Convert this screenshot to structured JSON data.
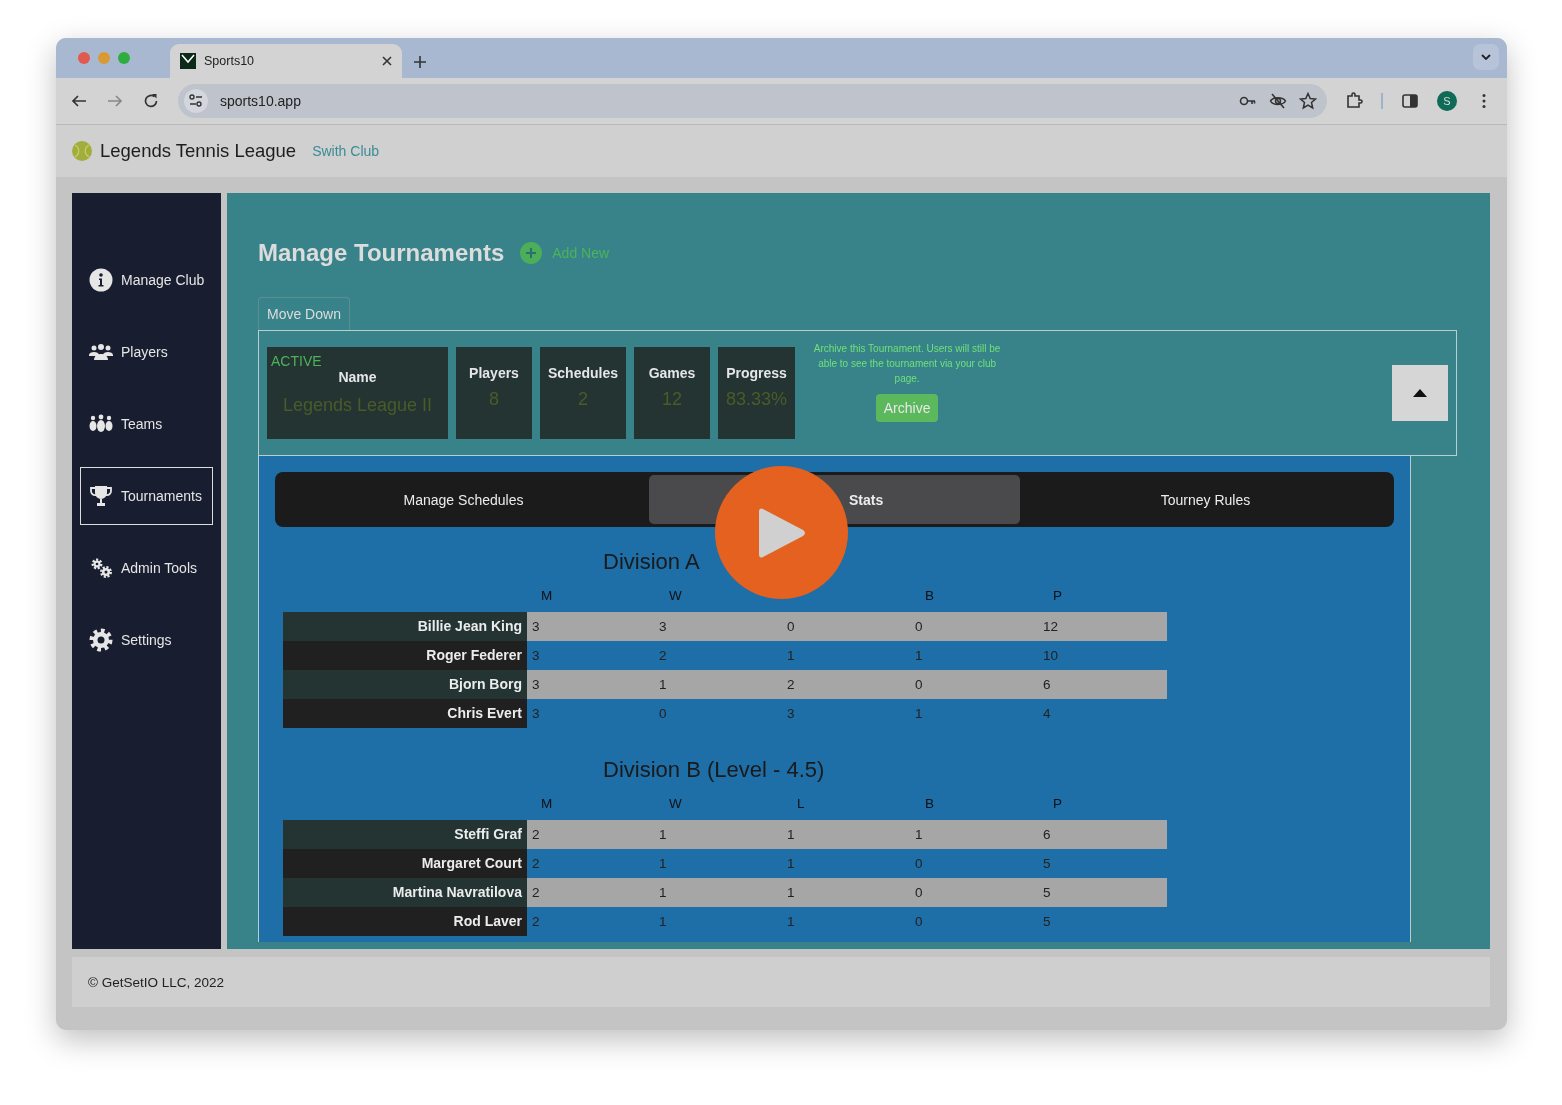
{
  "browser": {
    "tab_title": "Sports10",
    "url": "sports10.app",
    "avatar_letter": "S"
  },
  "header": {
    "title": "Legends Tennis League",
    "club_link": "Swith Club"
  },
  "sidebar": {
    "items": [
      {
        "label": "Manage Club",
        "selected": false
      },
      {
        "label": "Players",
        "selected": false
      },
      {
        "label": "Teams",
        "selected": false
      },
      {
        "label": "Tournaments",
        "selected": true
      },
      {
        "label": "Admin Tools",
        "selected": false
      },
      {
        "label": "Settings",
        "selected": false
      }
    ]
  },
  "page": {
    "title": "Manage Tournaments",
    "add_new": "Add New",
    "move_down": "Move Down"
  },
  "tournament": {
    "status": "ACTIVE",
    "stats": [
      {
        "label": "Name",
        "value": "Legends League II"
      },
      {
        "label": "Players",
        "value": "8"
      },
      {
        "label": "Schedules",
        "value": "2"
      },
      {
        "label": "Games",
        "value": "12"
      },
      {
        "label": "Progress",
        "value": "83.33%"
      }
    ],
    "archive_note": "Archive this Tournament. Users will still be able to see the tournament via your club page.",
    "archive_button": "Archive"
  },
  "tabs": [
    {
      "label": "Manage Schedules",
      "selected": false
    },
    {
      "label": "Stats",
      "selected": true
    },
    {
      "label": "Tourney Rules",
      "selected": false
    }
  ],
  "divisions": [
    {
      "title": "Division A",
      "columns": [
        "M",
        "W",
        null,
        "B",
        "P"
      ],
      "rows": [
        {
          "name": "Billie Jean King",
          "values": [
            "3",
            "3",
            "0",
            "0",
            "12"
          ]
        },
        {
          "name": "Roger Federer",
          "values": [
            "3",
            "2",
            "1",
            "1",
            "10"
          ]
        },
        {
          "name": "Bjorn Borg",
          "values": [
            "3",
            "1",
            "2",
            "0",
            "6"
          ]
        },
        {
          "name": "Chris Evert",
          "values": [
            "3",
            "0",
            "3",
            "1",
            "4"
          ]
        }
      ]
    },
    {
      "title": "Division B (Level - 4.5)",
      "columns": [
        "M",
        "W",
        "L",
        "B",
        "P"
      ],
      "rows": [
        {
          "name": "Steffi Graf",
          "values": [
            "2",
            "1",
            "1",
            "1",
            "6"
          ]
        },
        {
          "name": "Margaret Court",
          "values": [
            "2",
            "1",
            "1",
            "0",
            "5"
          ]
        },
        {
          "name": "Martina Navratilova",
          "values": [
            "2",
            "1",
            "1",
            "0",
            "5"
          ]
        },
        {
          "name": "Rod Laver",
          "values": [
            "2",
            "1",
            "1",
            "0",
            "5"
          ]
        }
      ]
    }
  ],
  "footer": "© GetSetIO LLC, 2022"
}
